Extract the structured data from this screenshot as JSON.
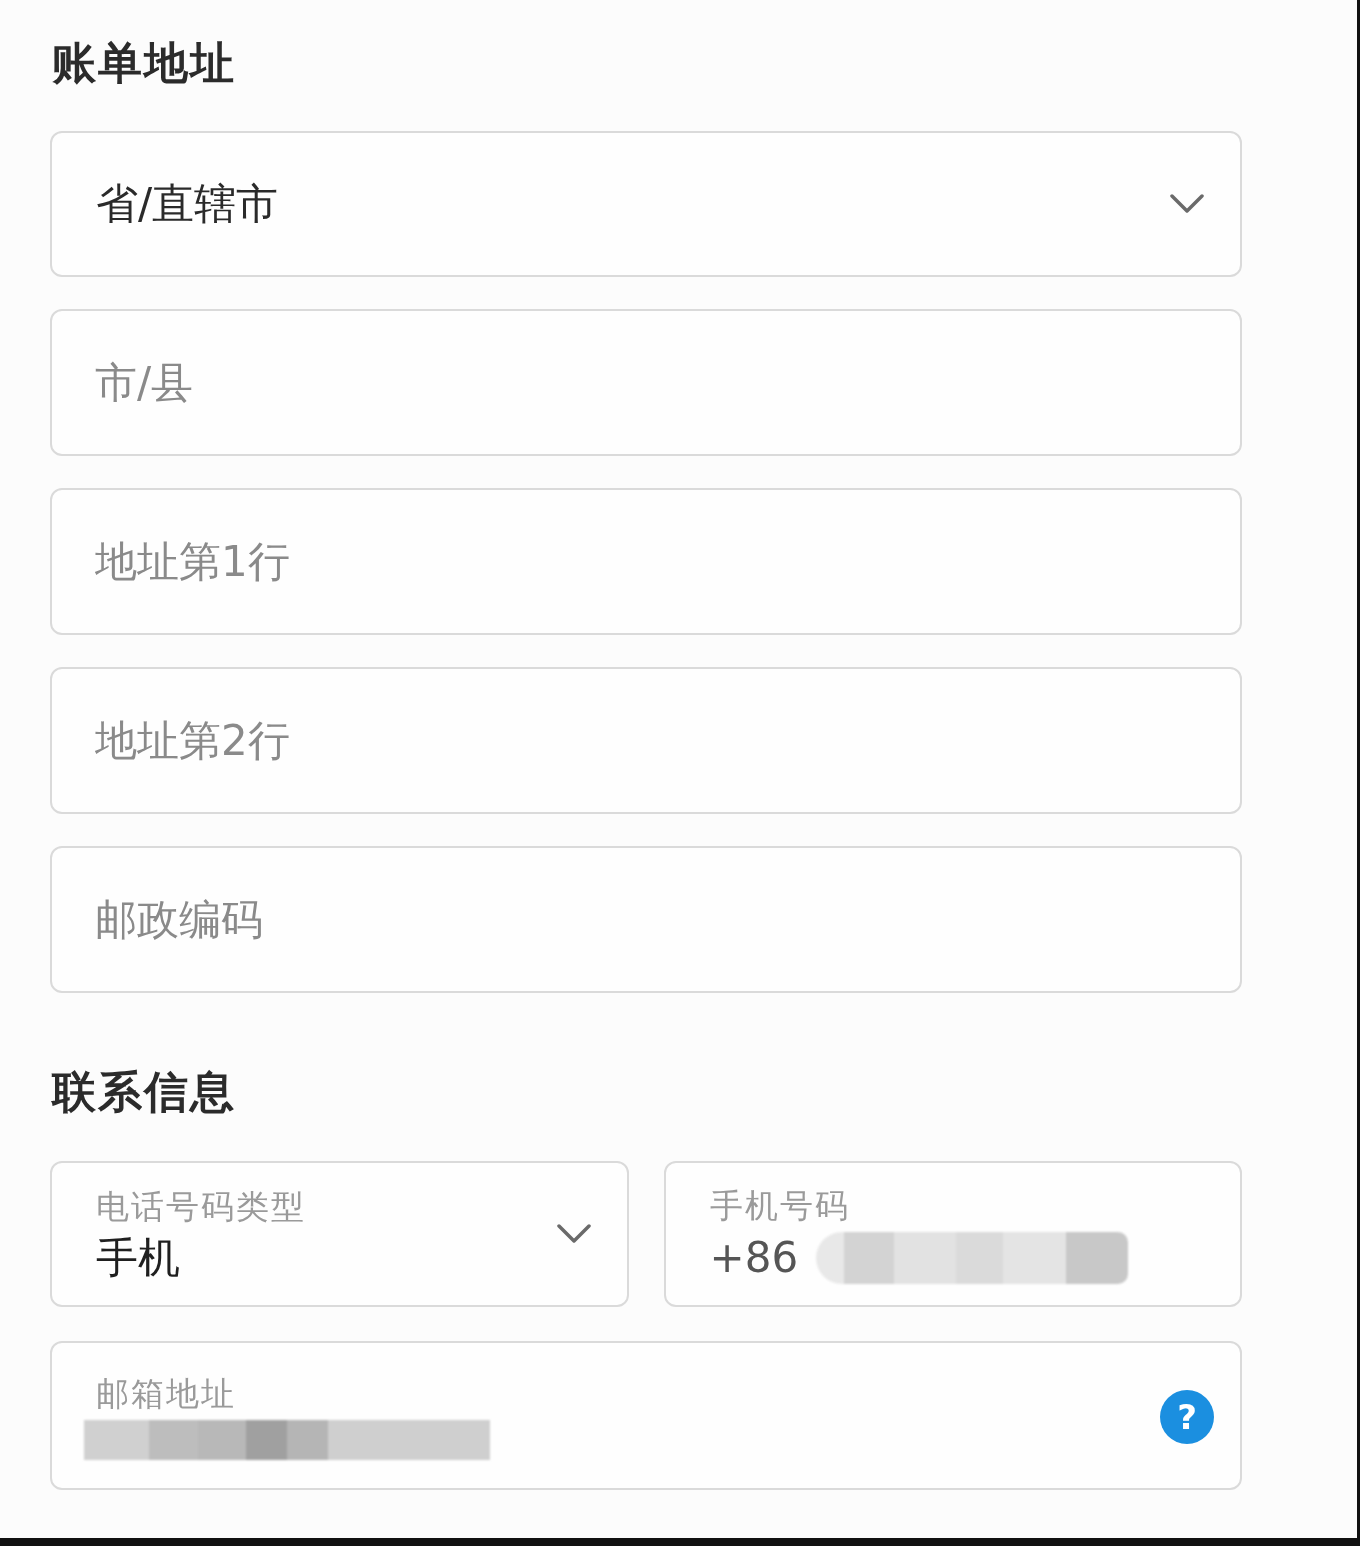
{
  "billing_address": {
    "heading": "账单地址",
    "fields": [
      {
        "kind": "select",
        "value": "省/直辖市"
      },
      {
        "kind": "text",
        "placeholder": "市/县"
      },
      {
        "kind": "text",
        "placeholder": "地址第1行"
      },
      {
        "kind": "text",
        "placeholder": "地址第2行"
      },
      {
        "kind": "text",
        "placeholder": "邮政编码"
      }
    ]
  },
  "contact_info": {
    "heading": "联系信息",
    "phone_type": {
      "kind": "select",
      "label": "电话号码类型",
      "value": "手机"
    },
    "phone_number": {
      "label": "手机号码",
      "prefix": "+86",
      "redacted": true
    },
    "email": {
      "label": "邮箱地址",
      "redacted": true,
      "help": "?"
    }
  }
}
